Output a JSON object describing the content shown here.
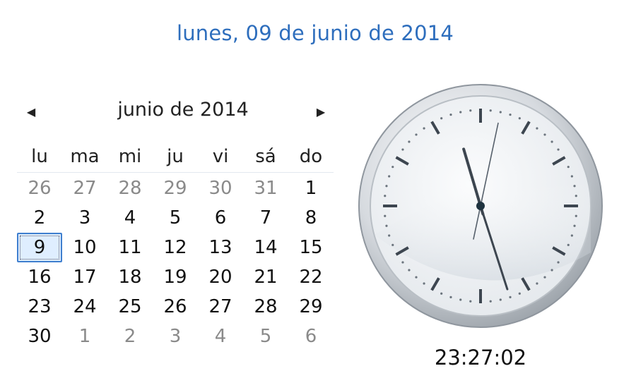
{
  "header": {
    "full_date": "lunes, 09 de junio de 2014"
  },
  "calendar": {
    "month_title": "junio de 2014",
    "prev_icon": "triangle-left-icon",
    "next_icon": "triangle-right-icon",
    "weekdays": [
      "lu",
      "ma",
      "mi",
      "ju",
      "vi",
      "sá",
      "do"
    ],
    "weeks": [
      [
        {
          "d": "26",
          "other": true
        },
        {
          "d": "27",
          "other": true
        },
        {
          "d": "28",
          "other": true
        },
        {
          "d": "29",
          "other": true
        },
        {
          "d": "30",
          "other": true
        },
        {
          "d": "31",
          "other": true
        },
        {
          "d": "1"
        }
      ],
      [
        {
          "d": "2"
        },
        {
          "d": "3"
        },
        {
          "d": "4"
        },
        {
          "d": "5"
        },
        {
          "d": "6"
        },
        {
          "d": "7"
        },
        {
          "d": "8"
        }
      ],
      [
        {
          "d": "9",
          "today": true
        },
        {
          "d": "10"
        },
        {
          "d": "11"
        },
        {
          "d": "12"
        },
        {
          "d": "13"
        },
        {
          "d": "14"
        },
        {
          "d": "15"
        }
      ],
      [
        {
          "d": "16"
        },
        {
          "d": "17"
        },
        {
          "d": "18"
        },
        {
          "d": "19"
        },
        {
          "d": "20"
        },
        {
          "d": "21"
        },
        {
          "d": "22"
        }
      ],
      [
        {
          "d": "23"
        },
        {
          "d": "24"
        },
        {
          "d": "25"
        },
        {
          "d": "26"
        },
        {
          "d": "27"
        },
        {
          "d": "28"
        },
        {
          "d": "29"
        }
      ],
      [
        {
          "d": "30"
        },
        {
          "d": "1",
          "other": true
        },
        {
          "d": "2",
          "other": true
        },
        {
          "d": "3",
          "other": true
        },
        {
          "d": "4",
          "other": true
        },
        {
          "d": "5",
          "other": true
        },
        {
          "d": "6",
          "other": true
        }
      ]
    ],
    "colors": {
      "today_border": "#3f7fcf",
      "today_fill": "#dfeeff",
      "other_month": "#8a8a8a"
    }
  },
  "clock": {
    "time_text": "23:27:02",
    "hours": 23,
    "minutes": 27,
    "seconds": 2,
    "colors": {
      "face": "#f2f4f6",
      "rim": "#a7adb4",
      "hands": "#3d4650",
      "header_text": "#2e6ebd"
    }
  }
}
